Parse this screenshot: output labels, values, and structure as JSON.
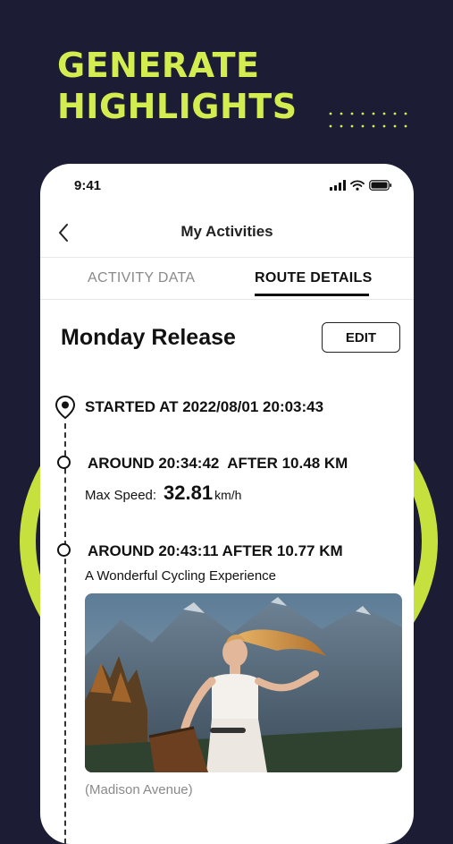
{
  "promo": {
    "headline_line1": "GENERATE",
    "headline_line2": "HIGHLIGHTS",
    "accent_color": "#d3ec4f",
    "background_color": "#1c1c35"
  },
  "status_bar": {
    "time": "9:41",
    "icons": [
      "signal-icon",
      "wifi-icon",
      "battery-icon"
    ]
  },
  "nav": {
    "back_icon": "chevron-left-icon",
    "title": "My Activities"
  },
  "tabs": [
    {
      "label": "ACTIVITY DATA",
      "selected": false
    },
    {
      "label": "ROUTE DETAILS",
      "selected": true
    }
  ],
  "activity": {
    "title": "Monday Release",
    "edit_label": "EDIT"
  },
  "timeline": {
    "start_icon": "location-pin-icon",
    "started_text": "STARTED AT 2022/08/01 20:03:43",
    "points": [
      {
        "time_text": "AROUND 20:34:42",
        "distance_text": "AFTER 10.48 KM",
        "stat_label": "Max Speed:",
        "stat_value": "32.81",
        "stat_unit": "km/h"
      },
      {
        "time_text": "AROUND 20:43:11",
        "distance_text": "AFTER 10.77 KM",
        "caption": "A Wonderful Cycling Experience",
        "location": "(Madison Avenue)"
      }
    ]
  }
}
